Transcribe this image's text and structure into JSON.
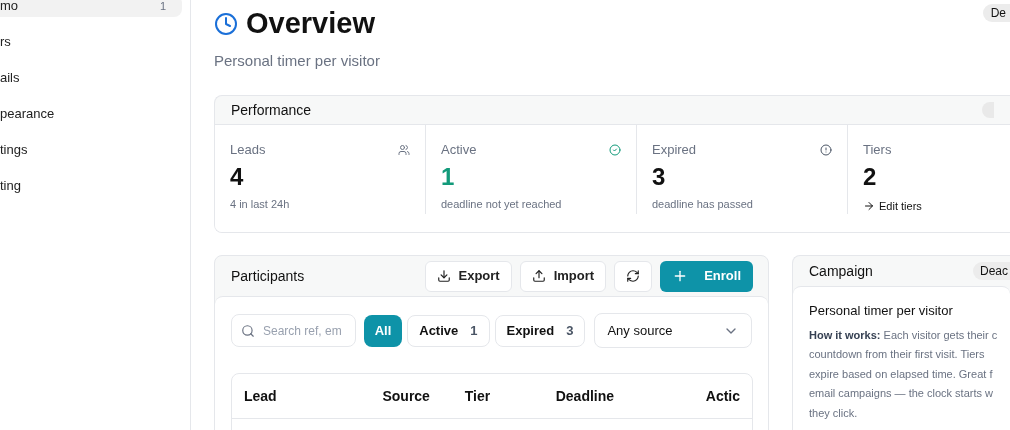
{
  "sidebar": {
    "items": [
      {
        "label": "mo",
        "count": "1",
        "selected": true
      },
      {
        "label": "rs",
        "selected": false
      },
      {
        "label": "ails",
        "selected": false
      },
      {
        "label": "pearance",
        "selected": false
      },
      {
        "label": "tings",
        "selected": false
      },
      {
        "label": "ting",
        "selected": false
      }
    ]
  },
  "header": {
    "title": "Overview",
    "subtitle": "Personal timer per visitor",
    "badge": "De"
  },
  "performance": {
    "title": "Performance",
    "stats": [
      {
        "kind": "leads",
        "label": "Leads",
        "value": "4",
        "note": "4 in last 24h"
      },
      {
        "kind": "active",
        "label": "Active",
        "value": "1",
        "note": "deadline not yet reached"
      },
      {
        "kind": "expired",
        "label": "Expired",
        "value": "3",
        "note": "deadline has passed"
      },
      {
        "kind": "link",
        "label": "Tiers",
        "value": "2",
        "link": "Edit tiers"
      }
    ]
  },
  "participants": {
    "title": "Participants",
    "buttons": [
      {
        "kind": "export",
        "label": "Export"
      },
      {
        "kind": "import",
        "label": "Import"
      },
      {
        "kind": "refresh"
      },
      {
        "kind": "enroll",
        "label": "Enroll"
      }
    ],
    "search": {
      "placeholder": "Search ref, em"
    },
    "filters": [
      {
        "label": "All",
        "selected": true
      },
      {
        "label": "Active",
        "count": "1",
        "selected": false
      },
      {
        "label": "Expired",
        "count": "3",
        "selected": false
      }
    ],
    "source": {
      "value": "Any source"
    },
    "table": {
      "columns": [
        "Lead",
        "Source",
        "Tier",
        "Deadline",
        "Actic"
      ]
    }
  },
  "campaign": {
    "title": "Campaign",
    "badge": "Deac",
    "heading": "Personal timer per visitor",
    "lines": [
      "**How it works:** Each visitor gets their c",
      "countdown from their first visit. Tiers",
      "expire based on elapsed time. Great f",
      "email campaigns — the clock starts w",
      "they click."
    ]
  }
}
